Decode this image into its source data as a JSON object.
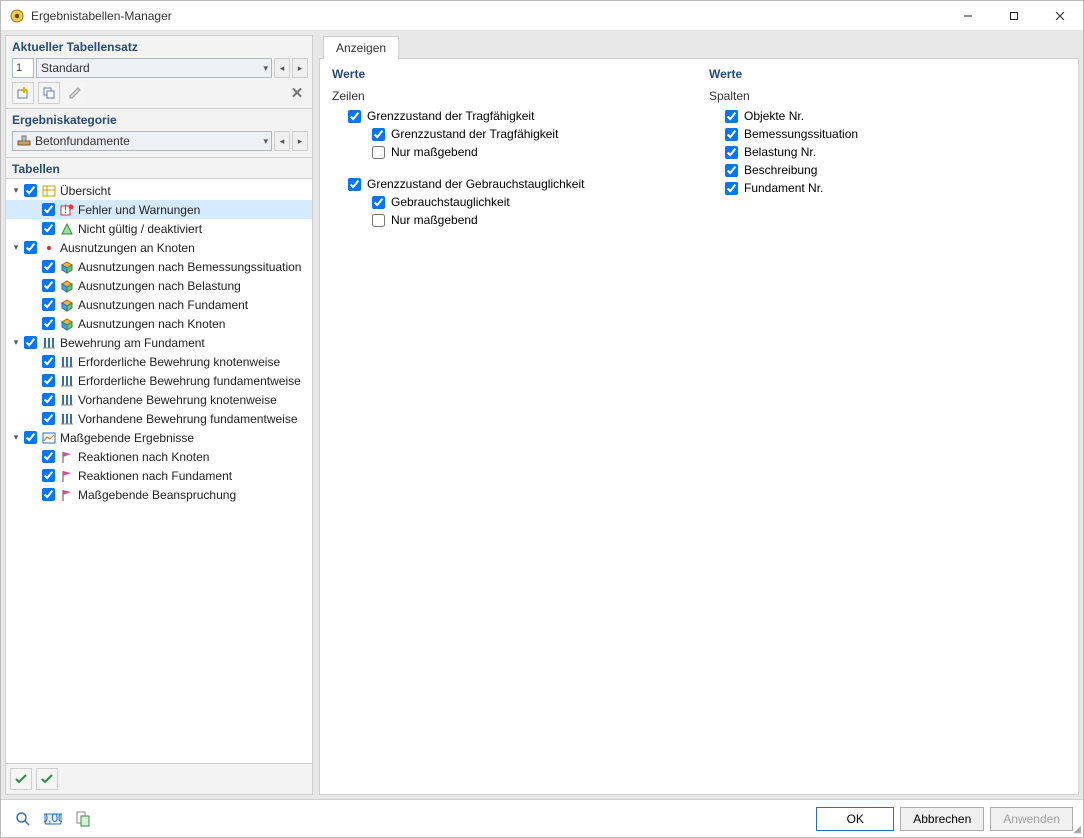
{
  "window": {
    "title": "Ergebnistabellen-Manager"
  },
  "left": {
    "tableset_header": "Aktueller Tabellensatz",
    "tableset_number": "1",
    "tableset_value": "Standard",
    "category_header": "Ergebniskategorie",
    "category_value": "Betonfundamente",
    "tables_header": "Tabellen"
  },
  "tree": [
    {
      "level": 0,
      "toggle": "v",
      "checked": true,
      "icon": "overview",
      "label": "Übersicht"
    },
    {
      "level": 1,
      "toggle": "",
      "checked": true,
      "icon": "error",
      "label": "Fehler und Warnungen",
      "selected": true
    },
    {
      "level": 1,
      "toggle": "",
      "checked": true,
      "icon": "invalid",
      "label": "Nicht gültig / deaktiviert"
    },
    {
      "level": 0,
      "toggle": "v",
      "checked": true,
      "icon": "dot",
      "label": "Ausnutzungen an Knoten"
    },
    {
      "level": 1,
      "toggle": "",
      "checked": true,
      "icon": "cube",
      "label": "Ausnutzungen nach Bemessungssituation"
    },
    {
      "level": 1,
      "toggle": "",
      "checked": true,
      "icon": "cube",
      "label": "Ausnutzungen nach Belastung"
    },
    {
      "level": 1,
      "toggle": "",
      "checked": true,
      "icon": "cube",
      "label": "Ausnutzungen nach Fundament"
    },
    {
      "level": 1,
      "toggle": "",
      "checked": true,
      "icon": "cube",
      "label": "Ausnutzungen nach Knoten"
    },
    {
      "level": 0,
      "toggle": "v",
      "checked": true,
      "icon": "rebar",
      "label": "Bewehrung am Fundament"
    },
    {
      "level": 1,
      "toggle": "",
      "checked": true,
      "icon": "rebar",
      "label": "Erforderliche Bewehrung knotenweise"
    },
    {
      "level": 1,
      "toggle": "",
      "checked": true,
      "icon": "rebar",
      "label": "Erforderliche Bewehrung fundamentweise"
    },
    {
      "level": 1,
      "toggle": "",
      "checked": true,
      "icon": "rebar",
      "label": "Vorhandene Bewehrung knotenweise"
    },
    {
      "level": 1,
      "toggle": "",
      "checked": true,
      "icon": "rebar",
      "label": "Vorhandene Bewehrung fundamentweise"
    },
    {
      "level": 0,
      "toggle": "v",
      "checked": true,
      "icon": "results",
      "label": "Maßgebende Ergebnisse"
    },
    {
      "level": 1,
      "toggle": "",
      "checked": true,
      "icon": "flag",
      "label": "Reaktionen nach Knoten"
    },
    {
      "level": 1,
      "toggle": "",
      "checked": true,
      "icon": "flag",
      "label": "Reaktionen nach Fundament"
    },
    {
      "level": 1,
      "toggle": "",
      "checked": true,
      "icon": "flag",
      "label": "Maßgebende Beanspruchung"
    }
  ],
  "tabs": {
    "anzeigen": "Anzeigen"
  },
  "rows": {
    "header": "Werte",
    "subheader": "Zeilen",
    "groups": [
      {
        "label": "Grenzzustand der Tragfähigkeit",
        "checked": true,
        "children": [
          {
            "label": "Grenzzustand der Tragfähigkeit",
            "checked": true
          },
          {
            "label": "Nur maßgebend",
            "checked": false
          }
        ]
      },
      {
        "label": "Grenzzustand der Gebrauchstauglichkeit",
        "checked": true,
        "children": [
          {
            "label": "Gebrauchstauglichkeit",
            "checked": true
          },
          {
            "label": "Nur maßgebend",
            "checked": false
          }
        ]
      }
    ]
  },
  "columns": {
    "header": "Werte",
    "subheader": "Spalten",
    "items": [
      {
        "label": "Objekte Nr.",
        "checked": true
      },
      {
        "label": "Bemessungssituation",
        "checked": true
      },
      {
        "label": "Belastung Nr.",
        "checked": true
      },
      {
        "label": "Beschreibung",
        "checked": true
      },
      {
        "label": "Fundament Nr.",
        "checked": true
      }
    ]
  },
  "footer": {
    "ok": "OK",
    "cancel": "Abbrechen",
    "apply": "Anwenden"
  }
}
